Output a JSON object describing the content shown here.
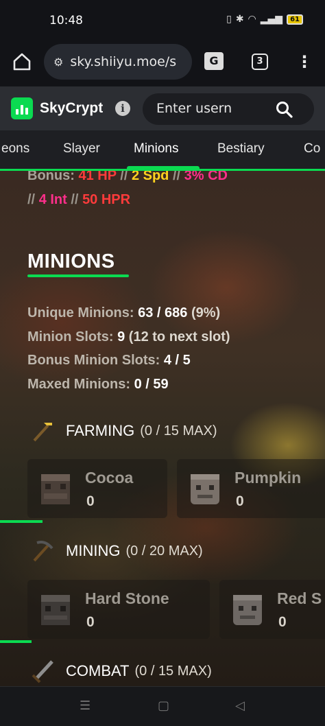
{
  "status_bar": {
    "time": "10:48",
    "battery": "61"
  },
  "browser": {
    "url": "sky.shiiyu.moe/s",
    "tab_count": "3",
    "translate_label": "G"
  },
  "app": {
    "brand": "SkyCrypt",
    "search_placeholder": "Enter usern"
  },
  "nav_tabs": [
    {
      "label": "eons"
    },
    {
      "label": "Slayer"
    },
    {
      "label": "Minions"
    },
    {
      "label": "Bestiary"
    },
    {
      "label": "Co"
    }
  ],
  "bonus": {
    "prefix": "Bonus:",
    "hp": "41 HP",
    "spd": "2 Spd",
    "cd": "3% CD",
    "int": "4 Int",
    "hpr": "50 HPR",
    "sep": "//"
  },
  "section": {
    "title": "MINIONS"
  },
  "stats": {
    "unique_label": "Unique Minions:",
    "unique_value": "63 / 686",
    "unique_note": "(9%)",
    "slots_label": "Minion Slots:",
    "slots_value": "9",
    "slots_note": "(12 to next slot)",
    "bonus_slots_label": "Bonus Minion Slots:",
    "bonus_slots_value": "4 / 5",
    "maxed_label": "Maxed Minions:",
    "maxed_value": "0 / 59"
  },
  "categories": {
    "farming": {
      "name": "FARMING",
      "count": "(0 / 15 MAX)",
      "minions": [
        {
          "name": "Cocoa",
          "value": "0"
        },
        {
          "name": "Pumpkin",
          "value": "0"
        }
      ]
    },
    "mining": {
      "name": "MINING",
      "count": "(0 / 20 MAX)",
      "minions": [
        {
          "name": "Hard Stone",
          "value": "0"
        },
        {
          "name": "Red S",
          "value": "0"
        }
      ]
    },
    "combat": {
      "name": "COMBAT",
      "count": "(0 / 15 MAX)"
    }
  },
  "colors": {
    "accent": "#0bda51",
    "red": "#ff3b3b",
    "pink": "#ff2f8b",
    "yellow": "#ffd21e"
  }
}
